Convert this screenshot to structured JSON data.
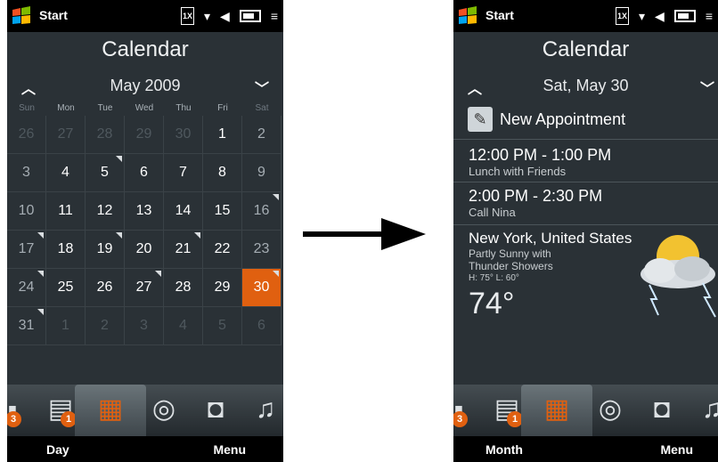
{
  "left": {
    "status": {
      "start_label": "Start"
    },
    "title": "Calendar",
    "month_label": "May 2009",
    "weekdays": [
      "Sun",
      "Mon",
      "Tue",
      "Wed",
      "Thu",
      "Fri",
      "Sat"
    ],
    "weeks": [
      [
        "26",
        "27",
        "28",
        "29",
        "30",
        "1",
        "2"
      ],
      [
        "3",
        "4",
        "5",
        "6",
        "7",
        "8",
        "9"
      ],
      [
        "10",
        "11",
        "12",
        "13",
        "14",
        "15",
        "16"
      ],
      [
        "17",
        "18",
        "19",
        "20",
        "21",
        "22",
        "23"
      ],
      [
        "24",
        "25",
        "26",
        "27",
        "28",
        "29",
        "30"
      ],
      [
        "31",
        "1",
        "2",
        "3",
        "4",
        "5",
        "6"
      ]
    ],
    "softkeys": {
      "left": "Day",
      "right": "Menu"
    },
    "tabs": {
      "badge_left": "3",
      "badge_messages": "1"
    }
  },
  "right": {
    "status": {
      "start_label": "Start"
    },
    "title": "Calendar",
    "date_label": "Sat, May 30",
    "new_appointment": "New Appointment",
    "appointments": [
      {
        "time": "12:00 PM - 1:00 PM",
        "desc": "Lunch with Friends"
      },
      {
        "time": "2:00 PM - 2:30 PM",
        "desc": "Call Nina"
      }
    ],
    "weather": {
      "city": "New York, United States",
      "condition": "Partly Sunny with Thunder Showers",
      "hi_lo": "H: 75° L: 60°",
      "temp": "74°"
    },
    "softkeys": {
      "left": "Month",
      "right": "Menu"
    },
    "tabs": {
      "badge_left": "3",
      "badge_messages": "1"
    }
  },
  "colors": {
    "accent": "#e06010",
    "panel": "#2a3136"
  }
}
